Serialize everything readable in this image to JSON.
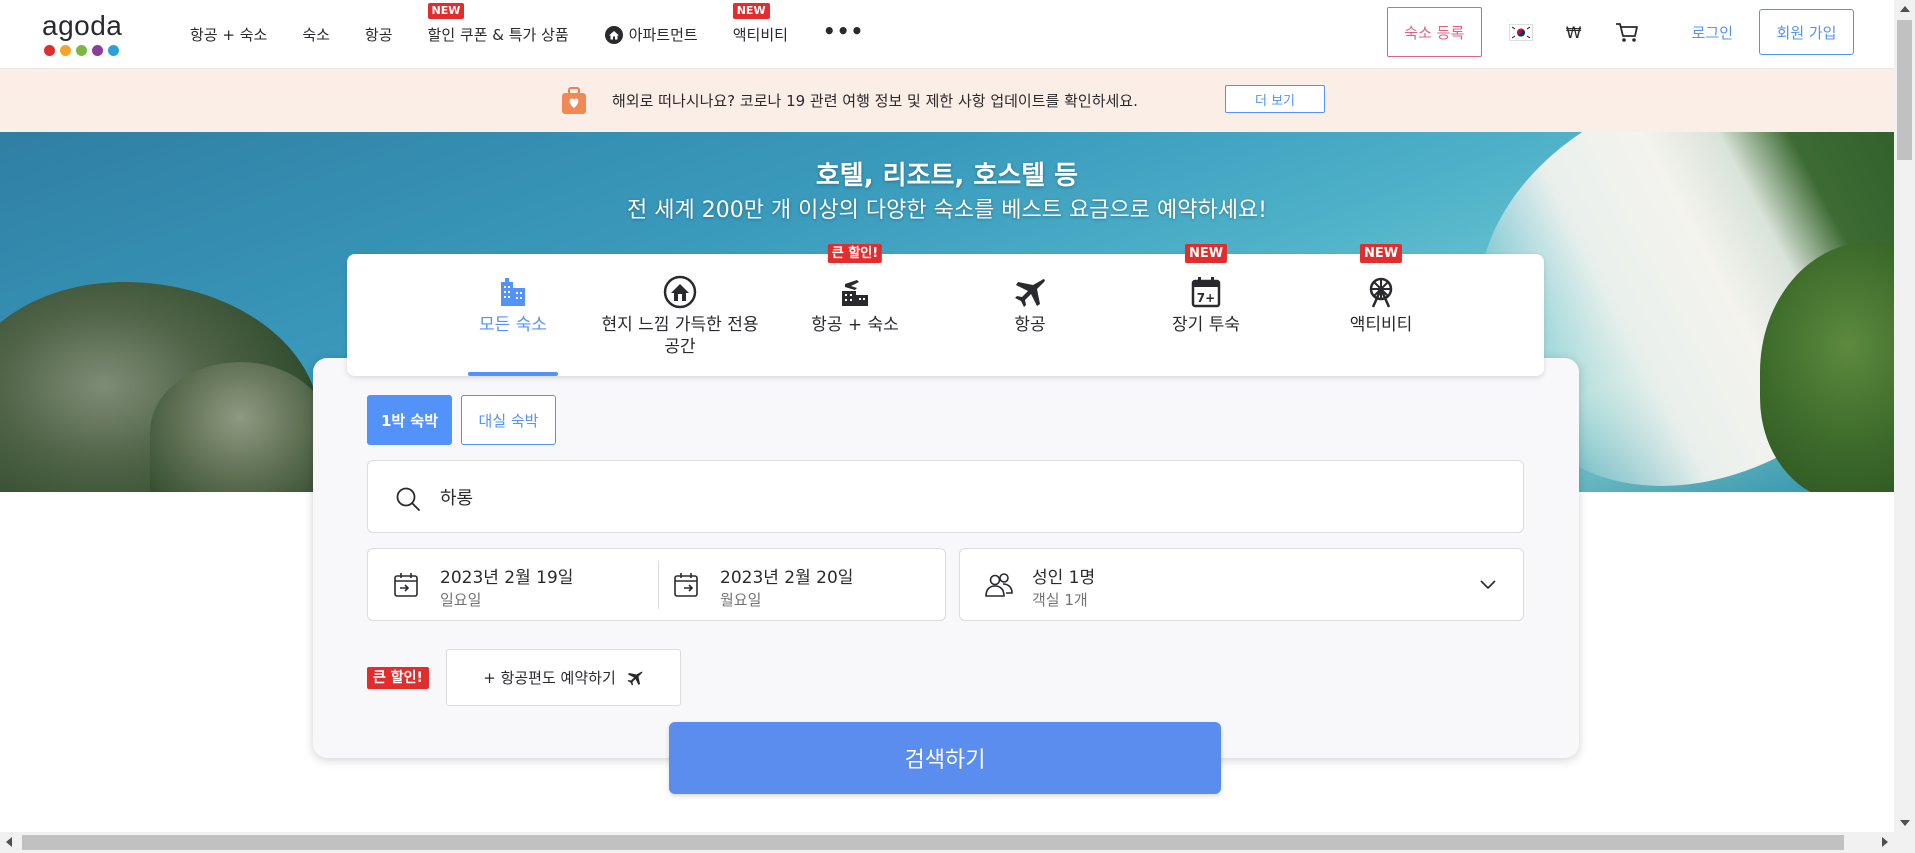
{
  "brand": {
    "name": "agoda",
    "dot_colors": [
      "#e12d2d",
      "#f4a428",
      "#7ab648",
      "#8c3d9c",
      "#2d9fd9"
    ]
  },
  "nav": {
    "items": [
      {
        "label": "항공 + 숙소",
        "badge": ""
      },
      {
        "label": "숙소",
        "badge": ""
      },
      {
        "label": "항공",
        "badge": ""
      },
      {
        "label": "할인 쿠폰 & 특가 상품",
        "badge": "NEW"
      },
      {
        "label": "아파트먼트",
        "badge": ""
      },
      {
        "label": "액티비티",
        "badge": "NEW"
      }
    ],
    "more": "•••"
  },
  "header_right": {
    "list_property": "숙소 등록",
    "currency": "₩",
    "login": "로그인",
    "signup": "회원 가입"
  },
  "notice": {
    "text": "해외로 떠나시나요? 코로나 19 관련 여행 정보 및 제한 사항 업데이트를 확인하세요.",
    "button": "더 보기"
  },
  "hero": {
    "title": "호텔, 리조트, 호스텔 등",
    "subtitle": "전 세계 200만 개 이상의 다양한 숙소를 베스트 요금으로 예약하세요!"
  },
  "tabs": [
    {
      "label": "모든 숙소",
      "badge": "",
      "active": true,
      "icon": "building-icon"
    },
    {
      "label": "현지 느낌 가득한 전용 공간",
      "badge": "",
      "active": false,
      "icon": "home-icon"
    },
    {
      "label": "항공 + 숙소",
      "badge": "큰 할인!",
      "active": false,
      "icon": "flight-hotel-icon"
    },
    {
      "label": "항공",
      "badge": "",
      "active": false,
      "icon": "plane-icon"
    },
    {
      "label": "장기 투숙",
      "badge": "NEW",
      "active": false,
      "icon": "calendar-7plus-icon"
    },
    {
      "label": "액티비티",
      "badge": "NEW",
      "active": false,
      "icon": "ferris-wheel-icon"
    }
  ],
  "stay_type": {
    "overnight": "1박 숙박",
    "dayuse": "대실 숙박"
  },
  "search": {
    "value": "하롱"
  },
  "checkin": {
    "date": "2023년 2월 19일",
    "day": "일요일"
  },
  "checkout": {
    "date": "2023년 2월 20일",
    "day": "월요일"
  },
  "occupancy": {
    "guests": "성인 1명",
    "rooms": "객실 1개"
  },
  "bundle": {
    "badge": "큰 할인!",
    "button": "+ 항공편도 예약하기"
  },
  "search_button": "검색하기",
  "colors": {
    "accent": "#5392f9",
    "badge_red": "#e12d2d",
    "pink": "#e0607e"
  }
}
